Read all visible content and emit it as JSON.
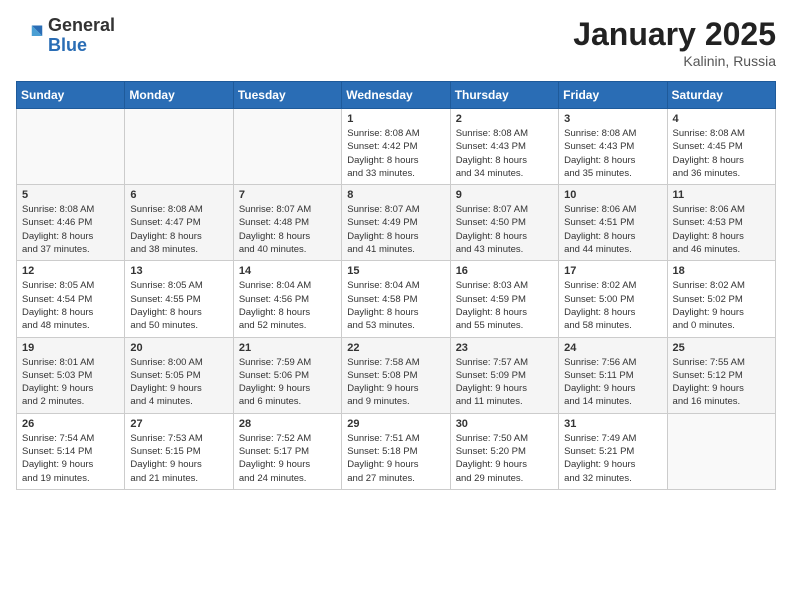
{
  "logo": {
    "general": "General",
    "blue": "Blue"
  },
  "title": "January 2025",
  "location": "Kalinin, Russia",
  "weekdays": [
    "Sunday",
    "Monday",
    "Tuesday",
    "Wednesday",
    "Thursday",
    "Friday",
    "Saturday"
  ],
  "weeks": [
    [
      {
        "day": "",
        "info": ""
      },
      {
        "day": "",
        "info": ""
      },
      {
        "day": "",
        "info": ""
      },
      {
        "day": "1",
        "info": "Sunrise: 8:08 AM\nSunset: 4:42 PM\nDaylight: 8 hours\nand 33 minutes."
      },
      {
        "day": "2",
        "info": "Sunrise: 8:08 AM\nSunset: 4:43 PM\nDaylight: 8 hours\nand 34 minutes."
      },
      {
        "day": "3",
        "info": "Sunrise: 8:08 AM\nSunset: 4:43 PM\nDaylight: 8 hours\nand 35 minutes."
      },
      {
        "day": "4",
        "info": "Sunrise: 8:08 AM\nSunset: 4:45 PM\nDaylight: 8 hours\nand 36 minutes."
      }
    ],
    [
      {
        "day": "5",
        "info": "Sunrise: 8:08 AM\nSunset: 4:46 PM\nDaylight: 8 hours\nand 37 minutes."
      },
      {
        "day": "6",
        "info": "Sunrise: 8:08 AM\nSunset: 4:47 PM\nDaylight: 8 hours\nand 38 minutes."
      },
      {
        "day": "7",
        "info": "Sunrise: 8:07 AM\nSunset: 4:48 PM\nDaylight: 8 hours\nand 40 minutes."
      },
      {
        "day": "8",
        "info": "Sunrise: 8:07 AM\nSunset: 4:49 PM\nDaylight: 8 hours\nand 41 minutes."
      },
      {
        "day": "9",
        "info": "Sunrise: 8:07 AM\nSunset: 4:50 PM\nDaylight: 8 hours\nand 43 minutes."
      },
      {
        "day": "10",
        "info": "Sunrise: 8:06 AM\nSunset: 4:51 PM\nDaylight: 8 hours\nand 44 minutes."
      },
      {
        "day": "11",
        "info": "Sunrise: 8:06 AM\nSunset: 4:53 PM\nDaylight: 8 hours\nand 46 minutes."
      }
    ],
    [
      {
        "day": "12",
        "info": "Sunrise: 8:05 AM\nSunset: 4:54 PM\nDaylight: 8 hours\nand 48 minutes."
      },
      {
        "day": "13",
        "info": "Sunrise: 8:05 AM\nSunset: 4:55 PM\nDaylight: 8 hours\nand 50 minutes."
      },
      {
        "day": "14",
        "info": "Sunrise: 8:04 AM\nSunset: 4:56 PM\nDaylight: 8 hours\nand 52 minutes."
      },
      {
        "day": "15",
        "info": "Sunrise: 8:04 AM\nSunset: 4:58 PM\nDaylight: 8 hours\nand 53 minutes."
      },
      {
        "day": "16",
        "info": "Sunrise: 8:03 AM\nSunset: 4:59 PM\nDaylight: 8 hours\nand 55 minutes."
      },
      {
        "day": "17",
        "info": "Sunrise: 8:02 AM\nSunset: 5:00 PM\nDaylight: 8 hours\nand 58 minutes."
      },
      {
        "day": "18",
        "info": "Sunrise: 8:02 AM\nSunset: 5:02 PM\nDaylight: 9 hours\nand 0 minutes."
      }
    ],
    [
      {
        "day": "19",
        "info": "Sunrise: 8:01 AM\nSunset: 5:03 PM\nDaylight: 9 hours\nand 2 minutes."
      },
      {
        "day": "20",
        "info": "Sunrise: 8:00 AM\nSunset: 5:05 PM\nDaylight: 9 hours\nand 4 minutes."
      },
      {
        "day": "21",
        "info": "Sunrise: 7:59 AM\nSunset: 5:06 PM\nDaylight: 9 hours\nand 6 minutes."
      },
      {
        "day": "22",
        "info": "Sunrise: 7:58 AM\nSunset: 5:08 PM\nDaylight: 9 hours\nand 9 minutes."
      },
      {
        "day": "23",
        "info": "Sunrise: 7:57 AM\nSunset: 5:09 PM\nDaylight: 9 hours\nand 11 minutes."
      },
      {
        "day": "24",
        "info": "Sunrise: 7:56 AM\nSunset: 5:11 PM\nDaylight: 9 hours\nand 14 minutes."
      },
      {
        "day": "25",
        "info": "Sunrise: 7:55 AM\nSunset: 5:12 PM\nDaylight: 9 hours\nand 16 minutes."
      }
    ],
    [
      {
        "day": "26",
        "info": "Sunrise: 7:54 AM\nSunset: 5:14 PM\nDaylight: 9 hours\nand 19 minutes."
      },
      {
        "day": "27",
        "info": "Sunrise: 7:53 AM\nSunset: 5:15 PM\nDaylight: 9 hours\nand 21 minutes."
      },
      {
        "day": "28",
        "info": "Sunrise: 7:52 AM\nSunset: 5:17 PM\nDaylight: 9 hours\nand 24 minutes."
      },
      {
        "day": "29",
        "info": "Sunrise: 7:51 AM\nSunset: 5:18 PM\nDaylight: 9 hours\nand 27 minutes."
      },
      {
        "day": "30",
        "info": "Sunrise: 7:50 AM\nSunset: 5:20 PM\nDaylight: 9 hours\nand 29 minutes."
      },
      {
        "day": "31",
        "info": "Sunrise: 7:49 AM\nSunset: 5:21 PM\nDaylight: 9 hours\nand 32 minutes."
      },
      {
        "day": "",
        "info": ""
      }
    ]
  ]
}
